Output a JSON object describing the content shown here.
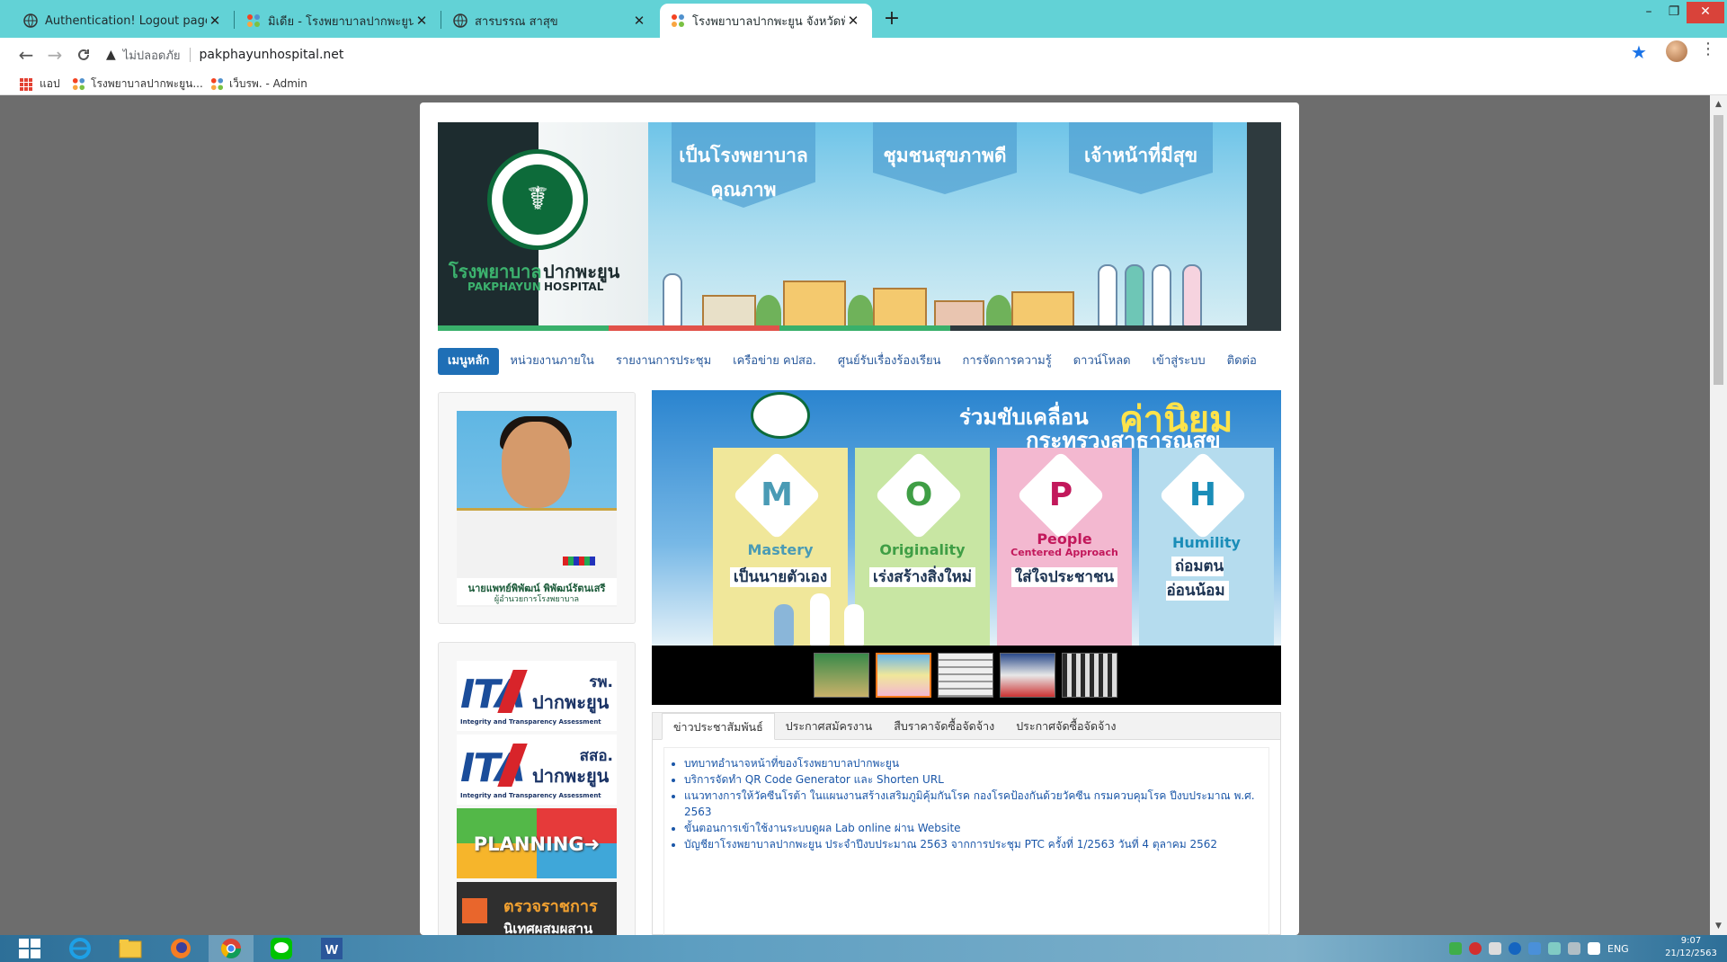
{
  "browser": {
    "tabs": [
      {
        "title": "Authentication! Logout page",
        "icon": "globe-icon",
        "active": false
      },
      {
        "title": "มิเดีย - โรงพยาบาลปากพะยูน จังหวัด",
        "icon": "joomla-icon",
        "active": false
      },
      {
        "title": "สารบรรณ สาสุข",
        "icon": "globe-icon",
        "active": false
      },
      {
        "title": "โรงพยาบาลปากพะยูน จังหวัดพัทลุง",
        "icon": "joomla-icon",
        "active": true
      }
    ],
    "new_tab_label": "+",
    "window_controls": {
      "minimize": "–",
      "restore": "❐",
      "close": "✕"
    },
    "nav": {
      "back": "←",
      "forward": "→",
      "reload": "C"
    },
    "omnibox": {
      "warning": "▲",
      "security_label": "ไม่ปลอดภัย",
      "url": "pakphayunhospital.net"
    },
    "bookmarks": [
      {
        "label": "แอป",
        "icon": "apps-icon"
      },
      {
        "label": "โรงพยาบาลปากพะยูน...",
        "icon": "joomla-icon"
      },
      {
        "label": "เว็บรพ. - Admin",
        "icon": "joomla-icon"
      }
    ],
    "star_icon": "★",
    "menu_icon": "⋮"
  },
  "site": {
    "banner": {
      "name_th_part1": "โรงพยาบาล",
      "name_th_part2": "ปากพะยูน",
      "name_en_part1": "PAKPHAYUN",
      "name_en_part2": "HOSPITAL",
      "seal_glyph": "☤",
      "taglines": [
        {
          "text": "เป็นโรงพยาบาลคุณภาพ"
        },
        {
          "text": "ชุมชนสุขภาพดี"
        },
        {
          "text": "เจ้าหน้าที่มีสุข"
        }
      ]
    },
    "menu": [
      {
        "label": "เมนูหลัก",
        "active": true
      },
      {
        "label": "หน่วยงานภายใน",
        "active": false
      },
      {
        "label": "รายงานการประชุม",
        "active": false
      },
      {
        "label": "เครือข่าย คปสอ.",
        "active": false
      },
      {
        "label": "ศูนย์รับเรื่องร้องเรียน",
        "active": false
      },
      {
        "label": "การจัดการความรู้",
        "active": false
      },
      {
        "label": "ดาวน์โหลด",
        "active": false
      },
      {
        "label": "เข้าสู่ระบบ",
        "active": false
      },
      {
        "label": "ติดต่อ",
        "active": false
      }
    ],
    "director": {
      "name": "นายแพทย์พิพัฒน์ พิพัฒน์รัตนเสรี",
      "title": "ผู้อำนวยการโรงพยาบาล"
    },
    "sidebar_links": [
      {
        "big": "ITA",
        "top": "รพ.",
        "bottom": "ปากพะยูน",
        "sub": "Integrity and Transparency Assessment"
      },
      {
        "big": "ITA",
        "top": "สสอ.",
        "bottom": "ปากพะยูน",
        "sub": "Integrity and Transparency Assessment"
      }
    ],
    "planning_label": "PLANNING➜",
    "inspect": {
      "line1": "ตรวจราชการ",
      "line2": "นิเทศผสมผสาน"
    },
    "slider": {
      "title_part1": "ร่วมขับเคลื่อน",
      "title_part2": "ค่านิยม",
      "title_line2": "กระทรวงสาธารณสุข",
      "values": [
        {
          "letter": "M",
          "en": "Mastery",
          "en_sub": "",
          "th": "เป็นนายตัวเอง",
          "color": "#4a9bb5",
          "bg": "#f0e79a"
        },
        {
          "letter": "O",
          "en": "Originality",
          "en_sub": "",
          "th": "เร่งสร้างสิ่งใหม่",
          "color": "#3f9e45",
          "bg": "#c8e6a3"
        },
        {
          "letter": "P",
          "en": "People",
          "en_sub": "Centered Approach",
          "th": "ใส่ใจประชาชน",
          "color": "#c2185b",
          "bg": "#f3b8d0"
        },
        {
          "letter": "H",
          "en": "Humility",
          "en_sub": "",
          "th": "ถ่อมตน อ่อนน้อม",
          "color": "#1a8db8",
          "bg": "#b5dcee"
        }
      ],
      "thumbnail_count": 5,
      "active_thumbnail": 2
    },
    "news_tabs": [
      {
        "label": "ข่าวประชาสัมพันธ์",
        "active": true
      },
      {
        "label": "ประกาศสมัครงาน",
        "active": false
      },
      {
        "label": "สืบราคาจัดซื้อจัดจ้าง",
        "active": false
      },
      {
        "label": "ประกาศจัดซื้อจัดจ้าง",
        "active": false
      }
    ],
    "news": [
      "บทบาทอำนาจหน้าที่ของโรงพยาบาลปากพะยูน",
      "บริการจัดทำ QR Code Generator และ Shorten URL",
      "แนวทางการให้วัคซีนโรต้า ในแผนงานสร้างเสริมภูมิคุ้มกันโรค กองโรคป้องกันด้วยวัคซีน กรมควบคุมโรค ปีงบประมาณ พ.ศ. 2563",
      "ขั้นตอนการเข้าใช้งานระบบดูผล Lab online ผ่าน Website",
      "บัญชียาโรงพยาบาลปากพะยูน ประจำปีงบประมาณ 2563 จากการประชุม PTC ครั้งที่ 1/2563 วันที่ 4 ตุลาคม 2562"
    ]
  },
  "taskbar": {
    "apps": [
      "windows-start",
      "internet-explorer",
      "file-explorer",
      "firefox",
      "chrome",
      "line",
      "word"
    ],
    "tray_lang": "ENG",
    "time": "9:07",
    "date": "21/12/2563"
  },
  "colors": {
    "tab_bar": "#62d2d6",
    "menu_active": "#1f6fb6",
    "link": "#1a56a8",
    "hospital_green": "#0d6b3a"
  }
}
